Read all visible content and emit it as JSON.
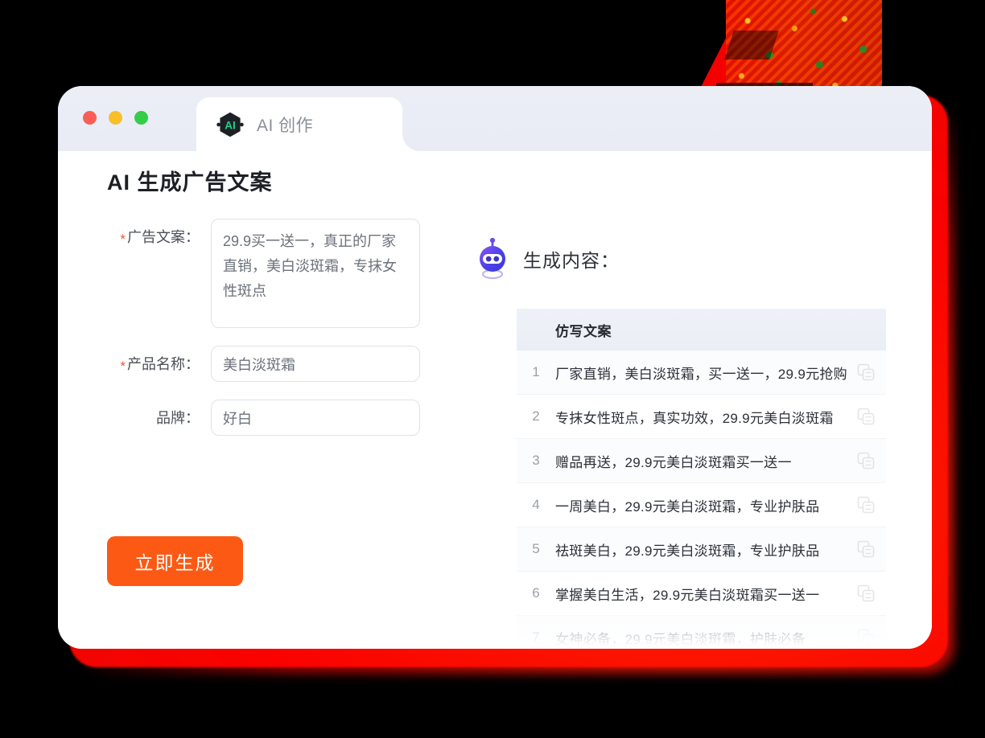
{
  "window": {
    "traffic_lights": [
      {
        "name": "close",
        "color": "#fb5e55"
      },
      {
        "name": "minimize",
        "color": "#f9bf2a"
      },
      {
        "name": "maximize",
        "color": "#35cc48"
      }
    ],
    "tab": {
      "label": "AI 创作",
      "icon": "ai-hexagon-icon",
      "icon_text": "AI",
      "icon_accent": "#1fd287"
    }
  },
  "left": {
    "title": "AI 生成广告文案",
    "required_marker": "*",
    "fields": [
      {
        "label": "广告文案：",
        "required": true,
        "type": "textarea",
        "value": "29.9买一送一，真正的厂家直销，美白淡斑霜，专抹女性斑点"
      },
      {
        "label": "产品名称：",
        "required": true,
        "type": "input",
        "value": "美白淡斑霜"
      },
      {
        "label": "品牌：",
        "required": false,
        "type": "input",
        "value": "好白"
      }
    ],
    "submit_button": {
      "label": "立即生成",
      "color": "#fc5a14"
    }
  },
  "right": {
    "icon": "robot-icon",
    "title": "生成内容：",
    "table": {
      "header": "仿写文案",
      "rows": [
        {
          "num": "1",
          "text": "厂家直销，美白淡斑霜，买一送一，29.9元抢购"
        },
        {
          "num": "2",
          "text": "专抹女性斑点，真实功效，29.9元美白淡斑霜"
        },
        {
          "num": "3",
          "text": "赠品再送，29.9元美白淡斑霜买一送一"
        },
        {
          "num": "4",
          "text": "一周美白，29.9元美白淡斑霜，专业护肤品"
        },
        {
          "num": "5",
          "text": "祛斑美白，29.9元美白淡斑霜，专业护肤品"
        },
        {
          "num": "6",
          "text": "掌握美白生活，29.9元美白淡斑霜买一送一"
        },
        {
          "num": "7",
          "text": "女神必备，29.9元美白淡斑霜，护肤必备"
        }
      ],
      "row_action_icon": "copy-icon"
    }
  },
  "decor": {
    "glow_color": "#f30500",
    "graphic": "red-textured-corner-graphic"
  }
}
